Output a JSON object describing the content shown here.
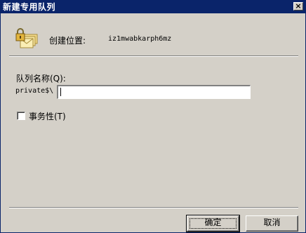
{
  "window": {
    "title": "新建专用队列",
    "close_glyph": "×"
  },
  "location": {
    "label": "创建位置:",
    "value": "iz1mwabkarph6mz"
  },
  "queue_name": {
    "label": "队列名称(Q):",
    "prefix": "private$\\",
    "value": ""
  },
  "transactional": {
    "label": "事务性(T)",
    "checked": false
  },
  "buttons": {
    "ok": "确定",
    "cancel": "取消"
  },
  "colors": {
    "titlebar": "#0a246a",
    "face": "#d4d0c8"
  },
  "icons": {
    "header": "locked-queue-envelopes-icon"
  }
}
